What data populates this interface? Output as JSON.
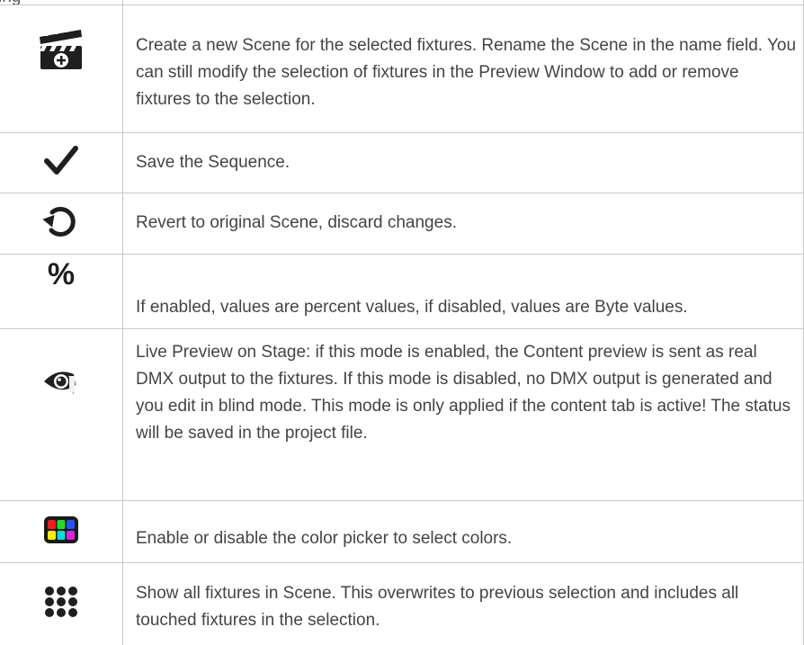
{
  "header_fragment": "ing",
  "rows": [
    {
      "icon": "scene-add-clapperboard-icon",
      "text": "Create a new Scene for the selected fixtures. Rename the Scene in the name field. You can still modify the selection of fixtures in the Preview Window to add or remove fixtures to the selection."
    },
    {
      "icon": "checkmark-icon",
      "text": "Save the Sequence."
    },
    {
      "icon": "revert-icon",
      "text": "Revert to original Scene, discard changes."
    },
    {
      "icon": "percent-icon",
      "symbol": "%",
      "text": "If enabled, values are percent values, if disabled, values are Byte values."
    },
    {
      "icon": "eye-live-preview-icon",
      "text": "Live Preview on Stage: if this mode is enabled, the Content preview is sent as real DMX output to the fixtures. If this mode is disabled, no DMX output is generated and you edit in blind mode. This mode is only applied if the content tab is active! The status will be saved in the project file."
    },
    {
      "icon": "color-picker-grid-icon",
      "text": "Enable or disable the color picker to select colors."
    },
    {
      "icon": "all-fixtures-dots-icon",
      "text": "Show all fixtures in Scene. This overwrites to previous selection and includes all touched fixtures in the selection."
    }
  ],
  "colors": {
    "border": "#c9c9c9",
    "text": "#444444",
    "icon": "#1f1f1f",
    "picker": [
      "#ff1a1a",
      "#22dd22",
      "#2255ff",
      "#ffee00",
      "#00dddd",
      "#dd22dd"
    ]
  }
}
